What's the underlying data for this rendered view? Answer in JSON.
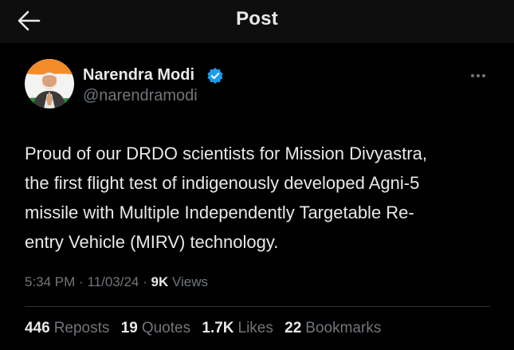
{
  "header": {
    "title": "Post",
    "back_icon": "arrow-left-icon"
  },
  "tweet": {
    "author": {
      "name": "Narendra Modi",
      "handle": "@narendramodi",
      "verified_icon": "verified-badge-icon",
      "verified_color": "#1d9bf0"
    },
    "more_icon": "more-horizontal-icon",
    "lines": [
      "Proud of our DRDO scientists for Mission Divyastra,",
      "the first flight test of indigenously developed Agni-5",
      "missile with Multiple Independently Targetable Re-",
      "entry Vehicle (MIRV) technology."
    ],
    "time": "5:34 PM",
    "date": "11/03/24",
    "separator": "·",
    "views_count": "9K",
    "views_label": "Views"
  },
  "stats": [
    {
      "count": "446",
      "label": "Reposts"
    },
    {
      "count": "19",
      "label": "Quotes"
    },
    {
      "count": "1.7K",
      "label": "Likes"
    },
    {
      "count": "22",
      "label": "Bookmarks"
    }
  ],
  "colors": {
    "background": "#000000",
    "header_background": "#0e0e0e",
    "text_primary": "#e7e9ea",
    "text_secondary": "#71767b",
    "divider": "#2f3336"
  }
}
